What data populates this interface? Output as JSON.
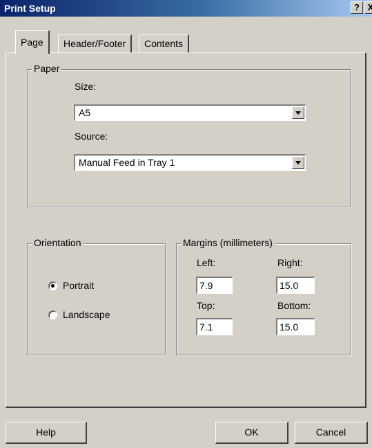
{
  "window": {
    "title": "Print Setup",
    "help_glyph": "?",
    "close_glyph": "X"
  },
  "tabs": [
    {
      "label": "Page",
      "active": true
    },
    {
      "label": "Header/Footer",
      "active": false
    },
    {
      "label": "Contents",
      "active": false
    }
  ],
  "paper": {
    "legend": "Paper",
    "size_label": "Size:",
    "size_value": "A5",
    "source_label": "Source:",
    "source_value": "Manual Feed in Tray 1"
  },
  "orientation": {
    "legend": "Orientation",
    "options": [
      {
        "label": "Portrait",
        "selected": true
      },
      {
        "label": "Landscape",
        "selected": false
      }
    ]
  },
  "margins": {
    "legend": "Margins (millimeters)",
    "left_label": "Left:",
    "left_value": "7.9",
    "right_label": "Right:",
    "right_value": "15.0",
    "top_label": "Top:",
    "top_value": "7.1",
    "bottom_label": "Bottom:",
    "bottom_value": "15.0"
  },
  "buttons": {
    "help": "Help",
    "ok": "OK",
    "cancel": "Cancel"
  },
  "colors": {
    "dialog_bg": "#d4d0c8",
    "titlebar_start": "#0a246a",
    "titlebar_end": "#a6caf0"
  }
}
